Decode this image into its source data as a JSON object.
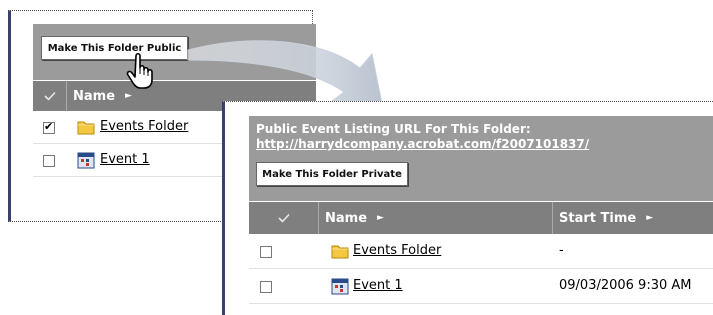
{
  "before_panel": {
    "make_public_button": "Make This Folder Public",
    "column_name": "Name",
    "rows": [
      {
        "name": "Events Folder",
        "checked": true,
        "icon": "folder-icon"
      },
      {
        "name": "Event 1",
        "checked": false,
        "icon": "event-icon"
      }
    ]
  },
  "after_panel": {
    "url_label": "Public Event Listing URL For This Folder:",
    "url_link": "http://harrydcompany.acrobat.com/f2007101837/",
    "make_private_button": "Make This Folder Private",
    "columns": {
      "name": "Name",
      "start_time": "Start Time"
    },
    "rows": [
      {
        "name": "Events Folder",
        "start_time": "-",
        "checked": false,
        "icon": "folder-icon"
      },
      {
        "name": "Event 1",
        "start_time": "09/03/2006 9:30 AM",
        "checked": false,
        "icon": "event-icon"
      }
    ]
  },
  "icons": {
    "sort": "sort-arrow-icon",
    "select_all": "checkmark-icon",
    "pointer": "hand-pointer-icon",
    "transition": "curved-arrow-icon"
  },
  "colors": {
    "header_bg": "#9b9b9b",
    "column_header_bg": "#7f7f7f",
    "panel_border": "#3b3f6e",
    "folder": "#f5c842"
  }
}
